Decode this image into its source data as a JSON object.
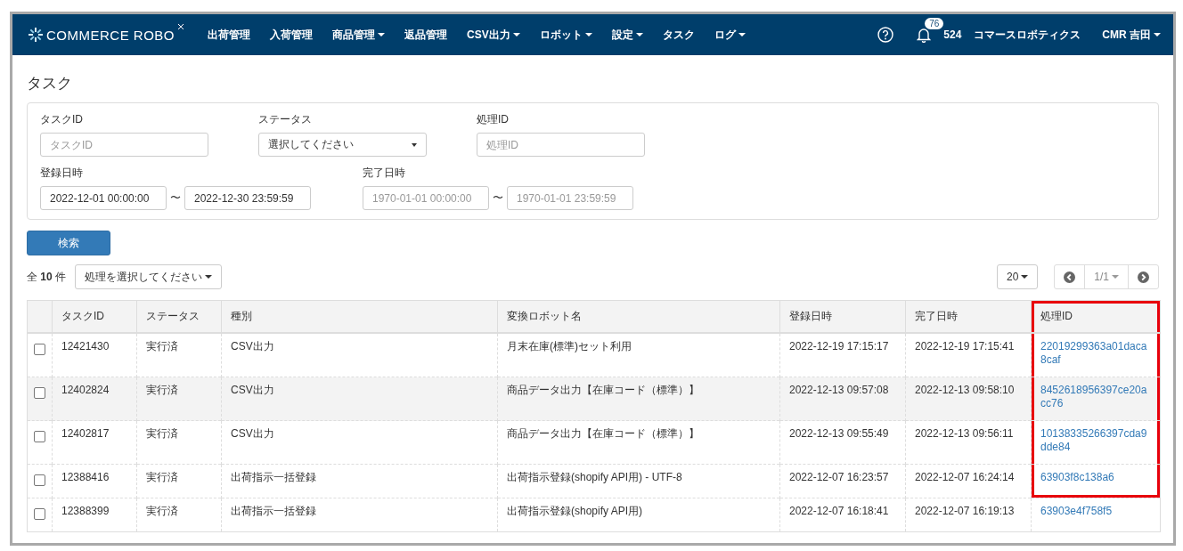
{
  "navbar": {
    "logo": "COMMERCE ROBO",
    "menu": [
      {
        "label": "出荷管理",
        "dropdown": false
      },
      {
        "label": "入荷管理",
        "dropdown": false
      },
      {
        "label": "商品管理",
        "dropdown": true
      },
      {
        "label": "返品管理",
        "dropdown": false
      },
      {
        "label": "CSV出力",
        "dropdown": true
      },
      {
        "label": "ロボット",
        "dropdown": true
      },
      {
        "label": "設定",
        "dropdown": true
      },
      {
        "label": "タスク",
        "dropdown": false
      },
      {
        "label": "ログ",
        "dropdown": true
      }
    ],
    "notification_count": "76",
    "shop_code": "524",
    "company": "コマースロボティクス",
    "user": "CMR 吉田"
  },
  "page_title": "タスク",
  "filters": [
    [
      {
        "kind": "text",
        "label": "タスクID",
        "placeholder": "タスクID"
      },
      {
        "kind": "select",
        "label": "ステータス",
        "value": "選択してください"
      },
      {
        "kind": "text",
        "label": "処理ID",
        "placeholder": "処理ID"
      }
    ],
    [
      {
        "kind": "range",
        "label": "登録日時",
        "from": {
          "value": "2022-12-01 00:00:00"
        },
        "separator": "〜",
        "to": {
          "value": "2022-12-30 23:59:59"
        }
      },
      {
        "kind": "range",
        "label": "完了日時",
        "from": {
          "placeholder": "1970-01-01 00:00:00"
        },
        "separator": "〜",
        "to": {
          "placeholder": "1970-01-01 23:59:59"
        }
      }
    ]
  ],
  "search_button": "検索",
  "toolbar": {
    "count": "全 **10** 件",
    "action_dropdown": "処理を選択してください",
    "per_page": "20",
    "page": "1/1"
  },
  "table": {
    "columns": [
      {
        "label": "タスクID",
        "framed": false
      },
      {
        "label": "ステータス",
        "framed": false
      },
      {
        "label": "種別",
        "framed": false
      },
      {
        "label": "変換ロボット名",
        "framed": false
      },
      {
        "label": "登録日時",
        "framed": false
      },
      {
        "label": "完了日時",
        "framed": false
      },
      {
        "label": "処理ID",
        "framed": true
      }
    ],
    "rows": [
      {
        "checked": false,
        "hovered": false,
        "framed": true,
        "cells": [
          "12421430",
          "実行済",
          "CSV出力",
          "月末在庫(標準)セット利用",
          "2022-12-19 17:15:17",
          "2022-12-19 17:15:41",
          "22019299363a01daca8caf"
        ]
      },
      {
        "checked": false,
        "hovered": true,
        "framed": true,
        "cells": [
          "12402824",
          "実行済",
          "CSV出力",
          "商品データ出力【在庫コード（標準）】",
          "2022-12-13 09:57:08",
          "2022-12-13 09:58:10",
          "8452618956397ce20acc76"
        ]
      },
      {
        "checked": false,
        "hovered": false,
        "framed": true,
        "cells": [
          "12402817",
          "実行済",
          "CSV出力",
          "商品データ出力【在庫コード（標準）】",
          "2022-12-13 09:55:49",
          "2022-12-13 09:56:11",
          "10138335266397cda9dde84"
        ]
      },
      {
        "checked": false,
        "hovered": false,
        "framed": true,
        "cells": [
          "12388416",
          "実行済",
          "出荷指示一括登録",
          "出荷指示登録(shopify API用) - UTF-8",
          "2022-12-07 16:23:57",
          "2022-12-07 16:24:14",
          "63903f8c138a6"
        ]
      },
      {
        "checked": false,
        "hovered": false,
        "framed": false,
        "cells": [
          "12388399",
          "実行済",
          "出荷指示一括登録",
          "出荷指示登録(shopify API用)",
          "2022-12-07 16:18:41",
          "2022-12-07 16:19:13",
          "63903e4f758f5"
        ]
      }
    ]
  }
}
